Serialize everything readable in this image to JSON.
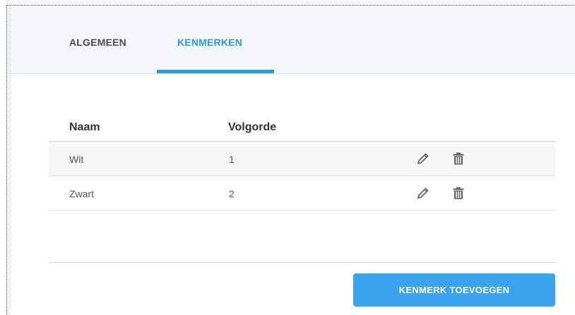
{
  "tabs": [
    {
      "label": "ALGEMEEN",
      "active": false
    },
    {
      "label": "KENMERKEN",
      "active": true
    }
  ],
  "colors": {
    "accent": "#2b9be8",
    "button": "#3aa3ee"
  },
  "table": {
    "columns": [
      "Naam",
      "Volgorde"
    ],
    "rows": [
      {
        "naam": "Wit",
        "volgorde": "1"
      },
      {
        "naam": "Zwart",
        "volgorde": "2"
      }
    ],
    "row_actions": [
      "pencil-icon",
      "trash-icon"
    ]
  },
  "actions": {
    "add_label": "KENMERK TOEVOEGEN"
  }
}
